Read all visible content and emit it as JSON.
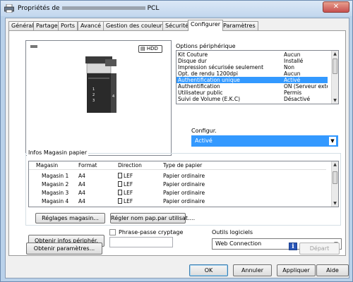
{
  "window": {
    "title_prefix": "Propriétés de",
    "title_suffix": "PCL",
    "close_label": "✕"
  },
  "tabs": [
    "Général",
    "Partage",
    "Ports",
    "Avancé",
    "Gestion des couleurs",
    "Sécurité",
    "Configurer",
    "Paramètres"
  ],
  "active_tab": "Configurer",
  "printer_preview": {
    "hdd_badge": "HDD",
    "tray_labels": [
      "1",
      "2",
      "3",
      "4"
    ]
  },
  "options": {
    "label": "Options périphérique",
    "rows": [
      {
        "name": "Kit Couture",
        "value": "Aucun"
      },
      {
        "name": "Disque dur",
        "value": "Installé"
      },
      {
        "name": "Impression sécurisée seulement",
        "value": "Non"
      },
      {
        "name": "Opt. de rendu 1200dpi",
        "value": "Aucun"
      },
      {
        "name": "Authentification unique",
        "value": "Activé",
        "selected": true
      },
      {
        "name": "Authentification",
        "value": "ON (Serveur exte..."
      },
      {
        "name": "Utilisateur public",
        "value": "Permis"
      },
      {
        "name": "Suivi de Volume (E.K.C)",
        "value": "Désactivé"
      }
    ],
    "config_label": "Configur.",
    "config_value": "Activé"
  },
  "magasin": {
    "label": "Infos Magasin papier",
    "headers": [
      "Magasin",
      "Format",
      "Direction",
      "Type de papier"
    ],
    "rows": [
      {
        "magasin": "Magasin 1",
        "format": "A4",
        "direction": "LEF",
        "type": "Papier ordinaire"
      },
      {
        "magasin": "Magasin 2",
        "format": "A4",
        "direction": "LEF",
        "type": "Papier ordinaire"
      },
      {
        "magasin": "Magasin 3",
        "format": "A4",
        "direction": "LEF",
        "type": "Papier ordinaire"
      },
      {
        "magasin": "Magasin 4",
        "format": "A4",
        "direction": "LEF",
        "type": "Papier ordinaire"
      }
    ],
    "btn_settings": "Réglages magasin...",
    "btn_rename": "Régler nom pap.par utilisat...."
  },
  "bottom": {
    "btn_get_info": "Obtenir infos périphér.",
    "passphrase_label": "Phrase-passe cryptage",
    "passphrase_value": "",
    "tools_label": "Outils logiciels",
    "tools_value": "Web Connection",
    "btn_get_params": "Obtenir paramètres...",
    "info_icon": "i",
    "btn_start": "Départ"
  },
  "footer": {
    "ok": "OK",
    "cancel": "Annuler",
    "apply": "Appliquer",
    "help": "Aide"
  }
}
